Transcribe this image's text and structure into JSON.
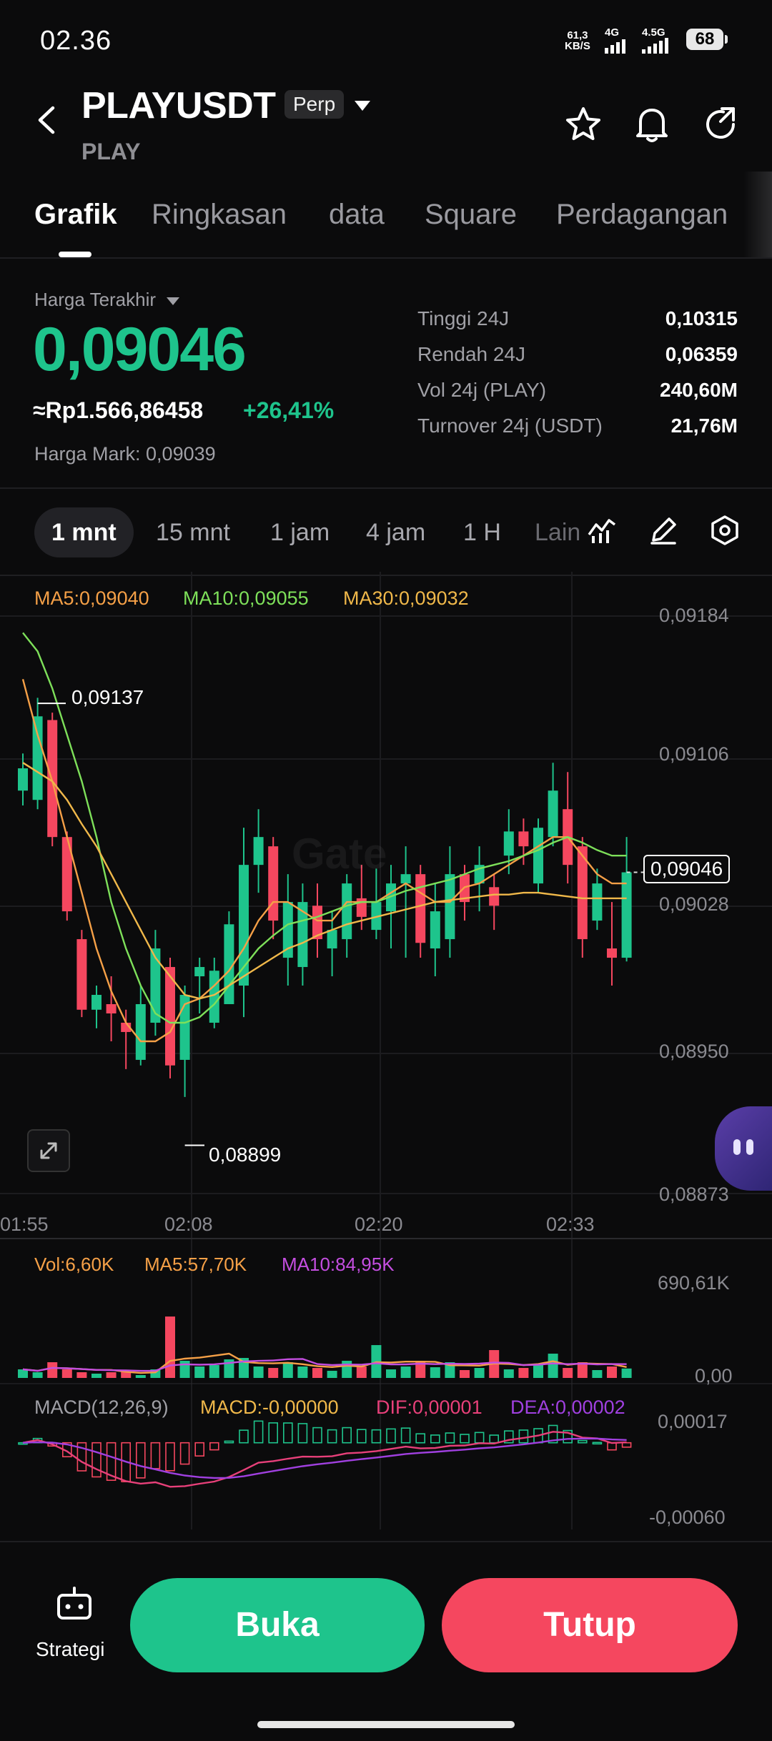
{
  "status_bar": {
    "time": "02.36",
    "net_speed": "61,3",
    "net_unit": "KB/S",
    "signal1": "4G",
    "signal2": "4.5G",
    "battery": "68"
  },
  "header": {
    "pair": "PLAYUSDT",
    "badge": "Perp",
    "subtitle": "PLAY"
  },
  "tabs": [
    "Grafik",
    "Ringkasan",
    "data",
    "Square",
    "Perdagangan"
  ],
  "ticker": {
    "last_label": "Harga Terakhir",
    "last_price": "0,09046",
    "idr_price": "≈Rp1.566,86458",
    "change_pct": "+26,41%",
    "mark_price": "Harga Mark: 0,09039",
    "stats": [
      {
        "label": "Tinggi 24J",
        "value": "0,10315"
      },
      {
        "label": "Rendah 24J",
        "value": "0,06359"
      },
      {
        "label": "Vol 24j (PLAY)",
        "value": "240,60M"
      },
      {
        "label": "Turnover 24j (USDT)",
        "value": "21,76M"
      }
    ]
  },
  "intervals": [
    "1 mnt",
    "15 mnt",
    "1 jam",
    "4 jam",
    "1 H",
    "Lain"
  ],
  "chart": {
    "ma_legend": {
      "ma5": "MA5:0,09040",
      "ma10": "MA10:0,09055",
      "ma30": "MA30:0,09032"
    },
    "y_labels": [
      "0,09184",
      "0,09106",
      "0,09028",
      "0,08950",
      "0,08873"
    ],
    "x_labels": [
      "01:55",
      "02:08",
      "02:20",
      "02:33"
    ],
    "high_marker": "0,09137",
    "low_marker": "0,08899",
    "current_tag": "0,09046",
    "watermark": "Gate",
    "vol_legend": {
      "vol": "Vol:6,60K",
      "ma5": "MA5:57,70K",
      "ma10": "MA10:84,95K"
    },
    "vol_axis": [
      "690,61K",
      "0,00"
    ],
    "macd_legend": {
      "title": "MACD(12,26,9)",
      "macd": "MACD:-0,00000",
      "dif": "DIF:0,00001",
      "dea": "DEA:0,00002"
    },
    "macd_axis": [
      "0,00017",
      "-0,00060"
    ],
    "colors": {
      "up": "#1ec48c",
      "down": "#f5475f",
      "ma5": "#f5a047",
      "ma10": "#7ee05a",
      "ma30": "#f0b84a",
      "vol_ma10": "#c44ee0",
      "dif": "#e8407a",
      "dea": "#a040e0"
    }
  },
  "chart_data": {
    "type": "candlestick",
    "series": [
      {
        "name": "PLAYUSDT",
        "candles": [
          {
            "o": 0.0909,
            "h": 0.0911,
            "l": 0.09082,
            "c": 0.09102
          },
          {
            "o": 0.09085,
            "h": 0.0914,
            "l": 0.0908,
            "c": 0.0913
          },
          {
            "o": 0.09128,
            "h": 0.09132,
            "l": 0.0906,
            "c": 0.09065
          },
          {
            "o": 0.09065,
            "h": 0.09068,
            "l": 0.0902,
            "c": 0.09025
          },
          {
            "o": 0.0901,
            "h": 0.09015,
            "l": 0.08968,
            "c": 0.08972
          },
          {
            "o": 0.08972,
            "h": 0.08985,
            "l": 0.08962,
            "c": 0.0898
          },
          {
            "o": 0.08975,
            "h": 0.0899,
            "l": 0.08955,
            "c": 0.0897
          },
          {
            "o": 0.08965,
            "h": 0.08972,
            "l": 0.0894,
            "c": 0.0896
          },
          {
            "o": 0.08945,
            "h": 0.08985,
            "l": 0.08942,
            "c": 0.08975
          },
          {
            "o": 0.08965,
            "h": 0.09015,
            "l": 0.08958,
            "c": 0.09005
          },
          {
            "o": 0.08995,
            "h": 0.09,
            "l": 0.08935,
            "c": 0.08942
          },
          {
            "o": 0.08945,
            "h": 0.08985,
            "l": 0.08925,
            "c": 0.0898
          },
          {
            "o": 0.0899,
            "h": 0.09,
            "l": 0.0897,
            "c": 0.08995
          },
          {
            "o": 0.08965,
            "h": 0.09,
            "l": 0.08962,
            "c": 0.08993
          },
          {
            "o": 0.08975,
            "h": 0.09025,
            "l": 0.08975,
            "c": 0.09018
          },
          {
            "o": 0.08985,
            "h": 0.0907,
            "l": 0.08968,
            "c": 0.0905
          },
          {
            "o": 0.0905,
            "h": 0.0908,
            "l": 0.09035,
            "c": 0.09065
          },
          {
            "o": 0.0906,
            "h": 0.09065,
            "l": 0.0901,
            "c": 0.0902
          },
          {
            "o": 0.09,
            "h": 0.09045,
            "l": 0.08985,
            "c": 0.0903
          },
          {
            "o": 0.08995,
            "h": 0.0904,
            "l": 0.08985,
            "c": 0.0903
          },
          {
            "o": 0.09028,
            "h": 0.0904,
            "l": 0.09,
            "c": 0.0901
          },
          {
            "o": 0.09005,
            "h": 0.09025,
            "l": 0.0899,
            "c": 0.09015
          },
          {
            "o": 0.0901,
            "h": 0.09045,
            "l": 0.09,
            "c": 0.0904
          },
          {
            "o": 0.09032,
            "h": 0.0905,
            "l": 0.09015,
            "c": 0.09022
          },
          {
            "o": 0.09015,
            "h": 0.09048,
            "l": 0.0901,
            "c": 0.0903
          },
          {
            "o": 0.09025,
            "h": 0.0905,
            "l": 0.09005,
            "c": 0.0904
          },
          {
            "o": 0.0904,
            "h": 0.0906,
            "l": 0.09,
            "c": 0.09045
          },
          {
            "o": 0.09045,
            "h": 0.0905,
            "l": 0.09,
            "c": 0.09008
          },
          {
            "o": 0.09005,
            "h": 0.0904,
            "l": 0.0899,
            "c": 0.09025
          },
          {
            "o": 0.0901,
            "h": 0.0906,
            "l": 0.09,
            "c": 0.09045
          },
          {
            "o": 0.09045,
            "h": 0.0905,
            "l": 0.0902,
            "c": 0.0903
          },
          {
            "o": 0.0904,
            "h": 0.0906,
            "l": 0.09025,
            "c": 0.0905
          },
          {
            "o": 0.09038,
            "h": 0.09045,
            "l": 0.09015,
            "c": 0.09028
          },
          {
            "o": 0.09055,
            "h": 0.0908,
            "l": 0.09045,
            "c": 0.09068
          },
          {
            "o": 0.09068,
            "h": 0.09075,
            "l": 0.0905,
            "c": 0.0906
          },
          {
            "o": 0.0904,
            "h": 0.09075,
            "l": 0.09035,
            "c": 0.0907
          },
          {
            "o": 0.09065,
            "h": 0.09105,
            "l": 0.0906,
            "c": 0.0909
          },
          {
            "o": 0.0908,
            "h": 0.091,
            "l": 0.0904,
            "c": 0.0905
          },
          {
            "o": 0.0906,
            "h": 0.09065,
            "l": 0.09,
            "c": 0.0901
          },
          {
            "o": 0.0902,
            "h": 0.09048,
            "l": 0.09015,
            "c": 0.0904
          },
          {
            "o": 0.09005,
            "h": 0.0903,
            "l": 0.08985,
            "c": 0.09
          },
          {
            "o": 0.09,
            "h": 0.09065,
            "l": 0.08998,
            "c": 0.09046
          }
        ],
        "volume": [
          60,
          40,
          110,
          60,
          40,
          30,
          40,
          45,
          20,
          60,
          430,
          120,
          80,
          90,
          130,
          140,
          80,
          70,
          110,
          80,
          70,
          50,
          120,
          80,
          230,
          60,
          80,
          120,
          75,
          110,
          55,
          70,
          195,
          60,
          70,
          90,
          170,
          70,
          110,
          55,
          80,
          66
        ],
        "ma5": [
          0.0915,
          0.0912,
          0.09095,
          0.09065,
          0.09035,
          0.09005,
          0.08982,
          0.08965,
          0.08955,
          0.08955,
          0.0896,
          0.08975,
          0.08978,
          0.08985,
          0.08993,
          0.09005,
          0.0902,
          0.0903,
          0.0903,
          0.09025,
          0.0902,
          0.0902,
          0.0903,
          0.0903,
          0.0903,
          0.09035,
          0.0904,
          0.09035,
          0.0903,
          0.0903,
          0.09038,
          0.0904,
          0.09045,
          0.0905,
          0.09055,
          0.0906,
          0.09065,
          0.09065,
          0.09055,
          0.09045,
          0.0904,
          0.0904
        ],
        "ma10": [
          0.09175,
          0.09165,
          0.09145,
          0.0912,
          0.09095,
          0.09065,
          0.0903,
          0.09005,
          0.08985,
          0.0897,
          0.08965,
          0.08965,
          0.08968,
          0.08975,
          0.08985,
          0.08995,
          0.09005,
          0.09012,
          0.09018,
          0.0902,
          0.09022,
          0.09025,
          0.09028,
          0.0903,
          0.0903,
          0.09033,
          0.09036,
          0.09038,
          0.0904,
          0.09042,
          0.09045,
          0.09048,
          0.0905,
          0.09052,
          0.09055,
          0.09058,
          0.09062,
          0.09065,
          0.09062,
          0.09058,
          0.09055,
          0.09055
        ],
        "ma30": [
          0.09105,
          0.091,
          0.09095,
          0.09085,
          0.09072,
          0.0906,
          0.09045,
          0.0903,
          0.09015,
          0.09,
          0.0899,
          0.0898,
          0.08978,
          0.0898,
          0.08985,
          0.0899,
          0.08995,
          0.09,
          0.09005,
          0.09008,
          0.09012,
          0.09015,
          0.09018,
          0.0902,
          0.09022,
          0.09024,
          0.09026,
          0.09028,
          0.0903,
          0.09031,
          0.09032,
          0.09033,
          0.09034,
          0.09034,
          0.09035,
          0.09035,
          0.09034,
          0.09033,
          0.09032,
          0.09032,
          0.09032,
          0.09032
        ]
      }
    ],
    "ylim": [
      0.08873,
      0.09184
    ],
    "x_ticks": [
      "01:55",
      "02:08",
      "02:20",
      "02:33"
    ],
    "grid": true
  }
}
